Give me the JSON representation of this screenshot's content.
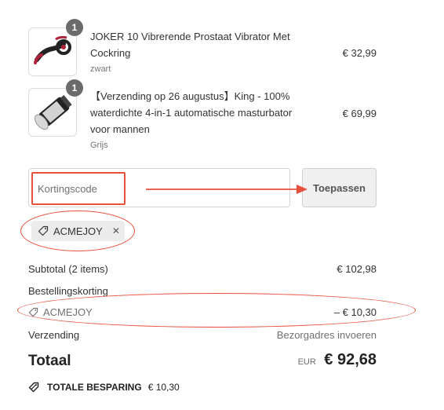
{
  "items": [
    {
      "quantity": "1",
      "name_line1": "JOKER 10 Vibrerende Prostaat Vibrator Met",
      "name_line2": "Cockring",
      "variant": "zwart",
      "price": "€ 32,99"
    },
    {
      "quantity": "1",
      "name_line1": "【Verzending op 26 augustus】King - 100%",
      "name_line2": "waterdichte 4-in-1 automatische masturbator",
      "name_line3": "voor mannen",
      "variant": "Grijs",
      "price": "€ 69,99"
    }
  ],
  "discount": {
    "placeholder": "Kortingscode",
    "apply_label": "Toepassen",
    "applied_code": "ACMEJOY",
    "remove_glyph": "✕"
  },
  "summary": {
    "subtotal_label": "Subtotal (2 items)",
    "subtotal_value": "€ 102,98",
    "order_discount_label": "Bestellingskorting",
    "discount_code": "ACMEJOY",
    "discount_value": "– € 10,30",
    "shipping_label": "Verzending",
    "shipping_value": "Bezorgadres invoeren",
    "total_label": "Totaal",
    "currency": "EUR",
    "total_value": "€ 92,68",
    "savings_label": "TOTALE BESPARING",
    "savings_value": "€ 10,30"
  },
  "annotation_color": "#e8503d",
  "icons": [
    "tag-icon",
    "close-icon",
    "arrow-right-icon"
  ]
}
